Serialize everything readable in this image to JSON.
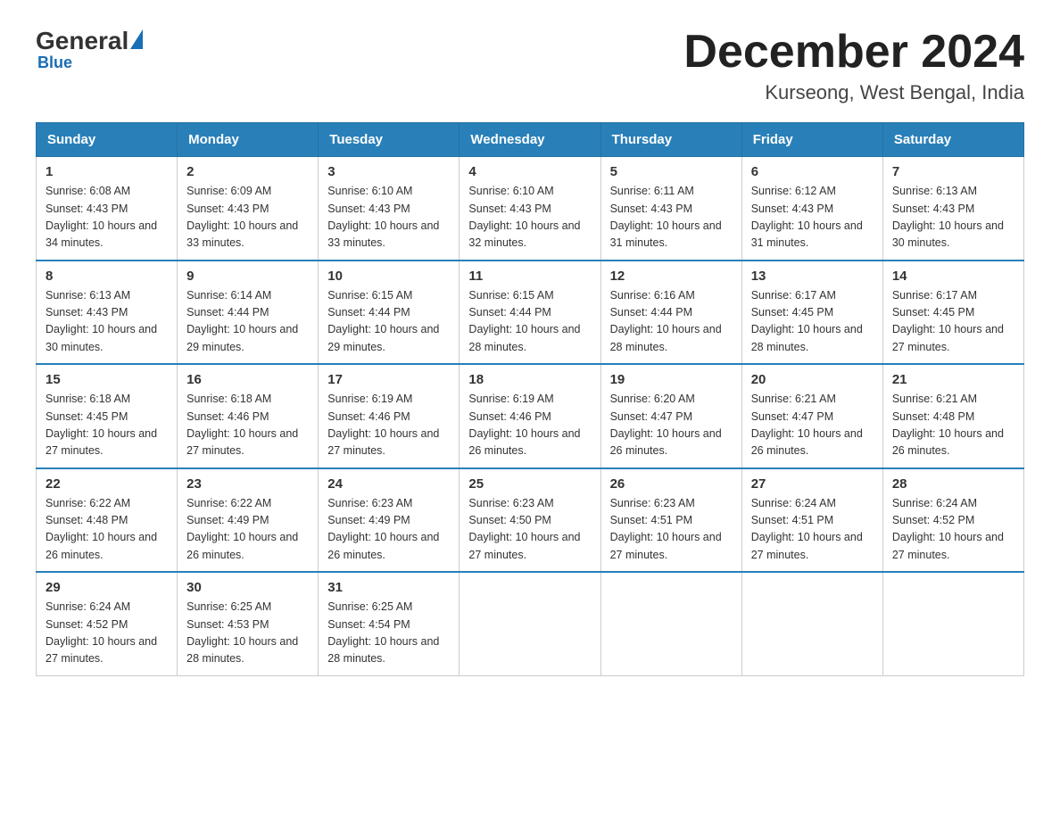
{
  "header": {
    "logo_general": "General",
    "logo_blue": "Blue",
    "month_title": "December 2024",
    "location": "Kurseong, West Bengal, India"
  },
  "weekdays": [
    "Sunday",
    "Monday",
    "Tuesday",
    "Wednesday",
    "Thursday",
    "Friday",
    "Saturday"
  ],
  "weeks": [
    [
      {
        "day": "1",
        "sunrise": "6:08 AM",
        "sunset": "4:43 PM",
        "daylight": "10 hours and 34 minutes."
      },
      {
        "day": "2",
        "sunrise": "6:09 AM",
        "sunset": "4:43 PM",
        "daylight": "10 hours and 33 minutes."
      },
      {
        "day": "3",
        "sunrise": "6:10 AM",
        "sunset": "4:43 PM",
        "daylight": "10 hours and 33 minutes."
      },
      {
        "day": "4",
        "sunrise": "6:10 AM",
        "sunset": "4:43 PM",
        "daylight": "10 hours and 32 minutes."
      },
      {
        "day": "5",
        "sunrise": "6:11 AM",
        "sunset": "4:43 PM",
        "daylight": "10 hours and 31 minutes."
      },
      {
        "day": "6",
        "sunrise": "6:12 AM",
        "sunset": "4:43 PM",
        "daylight": "10 hours and 31 minutes."
      },
      {
        "day": "7",
        "sunrise": "6:13 AM",
        "sunset": "4:43 PM",
        "daylight": "10 hours and 30 minutes."
      }
    ],
    [
      {
        "day": "8",
        "sunrise": "6:13 AM",
        "sunset": "4:43 PM",
        "daylight": "10 hours and 30 minutes."
      },
      {
        "day": "9",
        "sunrise": "6:14 AM",
        "sunset": "4:44 PM",
        "daylight": "10 hours and 29 minutes."
      },
      {
        "day": "10",
        "sunrise": "6:15 AM",
        "sunset": "4:44 PM",
        "daylight": "10 hours and 29 minutes."
      },
      {
        "day": "11",
        "sunrise": "6:15 AM",
        "sunset": "4:44 PM",
        "daylight": "10 hours and 28 minutes."
      },
      {
        "day": "12",
        "sunrise": "6:16 AM",
        "sunset": "4:44 PM",
        "daylight": "10 hours and 28 minutes."
      },
      {
        "day": "13",
        "sunrise": "6:17 AM",
        "sunset": "4:45 PM",
        "daylight": "10 hours and 28 minutes."
      },
      {
        "day": "14",
        "sunrise": "6:17 AM",
        "sunset": "4:45 PM",
        "daylight": "10 hours and 27 minutes."
      }
    ],
    [
      {
        "day": "15",
        "sunrise": "6:18 AM",
        "sunset": "4:45 PM",
        "daylight": "10 hours and 27 minutes."
      },
      {
        "day": "16",
        "sunrise": "6:18 AM",
        "sunset": "4:46 PM",
        "daylight": "10 hours and 27 minutes."
      },
      {
        "day": "17",
        "sunrise": "6:19 AM",
        "sunset": "4:46 PM",
        "daylight": "10 hours and 27 minutes."
      },
      {
        "day": "18",
        "sunrise": "6:19 AM",
        "sunset": "4:46 PM",
        "daylight": "10 hours and 26 minutes."
      },
      {
        "day": "19",
        "sunrise": "6:20 AM",
        "sunset": "4:47 PM",
        "daylight": "10 hours and 26 minutes."
      },
      {
        "day": "20",
        "sunrise": "6:21 AM",
        "sunset": "4:47 PM",
        "daylight": "10 hours and 26 minutes."
      },
      {
        "day": "21",
        "sunrise": "6:21 AM",
        "sunset": "4:48 PM",
        "daylight": "10 hours and 26 minutes."
      }
    ],
    [
      {
        "day": "22",
        "sunrise": "6:22 AM",
        "sunset": "4:48 PM",
        "daylight": "10 hours and 26 minutes."
      },
      {
        "day": "23",
        "sunrise": "6:22 AM",
        "sunset": "4:49 PM",
        "daylight": "10 hours and 26 minutes."
      },
      {
        "day": "24",
        "sunrise": "6:23 AM",
        "sunset": "4:49 PM",
        "daylight": "10 hours and 26 minutes."
      },
      {
        "day": "25",
        "sunrise": "6:23 AM",
        "sunset": "4:50 PM",
        "daylight": "10 hours and 27 minutes."
      },
      {
        "day": "26",
        "sunrise": "6:23 AM",
        "sunset": "4:51 PM",
        "daylight": "10 hours and 27 minutes."
      },
      {
        "day": "27",
        "sunrise": "6:24 AM",
        "sunset": "4:51 PM",
        "daylight": "10 hours and 27 minutes."
      },
      {
        "day": "28",
        "sunrise": "6:24 AM",
        "sunset": "4:52 PM",
        "daylight": "10 hours and 27 minutes."
      }
    ],
    [
      {
        "day": "29",
        "sunrise": "6:24 AM",
        "sunset": "4:52 PM",
        "daylight": "10 hours and 27 minutes."
      },
      {
        "day": "30",
        "sunrise": "6:25 AM",
        "sunset": "4:53 PM",
        "daylight": "10 hours and 28 minutes."
      },
      {
        "day": "31",
        "sunrise": "6:25 AM",
        "sunset": "4:54 PM",
        "daylight": "10 hours and 28 minutes."
      },
      null,
      null,
      null,
      null
    ]
  ]
}
